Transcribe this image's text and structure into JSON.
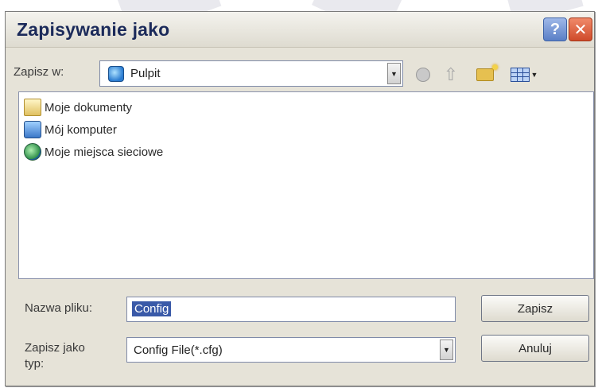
{
  "dialog": {
    "title": "Zapisywanie jako"
  },
  "titlebar_buttons": {
    "help": "?",
    "close": "✕"
  },
  "save_in": {
    "label": "Zapisz w:",
    "value": "Pulpit"
  },
  "files": [
    {
      "name": "Moje dokumenty",
      "icon": "my-documents-icon"
    },
    {
      "name": "Mój komputer",
      "icon": "my-computer-icon"
    },
    {
      "name": "Moje miejsca sieciowe",
      "icon": "network-places-icon"
    }
  ],
  "filename": {
    "label": "Nazwa pliku:",
    "value": "Config"
  },
  "filetype": {
    "label_line1": "Zapisz jako",
    "label_line2": "typ:",
    "value": "Config File(*.cfg)"
  },
  "buttons": {
    "save": "Zapisz",
    "cancel": "Anuluj"
  }
}
